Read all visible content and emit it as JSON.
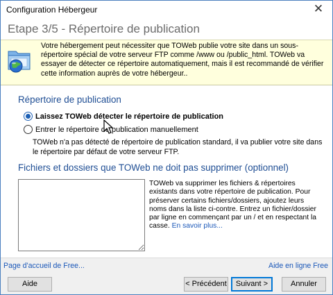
{
  "window": {
    "title": "Configuration Hébergeur",
    "close_glyph": "✕"
  },
  "step": {
    "title": "Etape 3/5 - Répertoire de publication"
  },
  "info": {
    "icon": "folder-globe-icon",
    "text": "Votre hébergement peut nécessiter que TOWeb publie votre site dans un sous-répertoire spécial de votre serveur FTP comme /www ou /public_html. TOWeb va essayer de détecter ce répertoire automatiquement, mais il est recommandé de vérifier cette information auprès de votre hébergeur.."
  },
  "publication": {
    "header": "Répertoire de publication",
    "option_auto": "Laissez TOWeb détecter le répertoire de publication",
    "option_manual": "Entrer le répertoire de publication manuellement",
    "selected": "auto",
    "description": "TOWeb n'a pas détecté de répertoire de publication standard, il va publier votre site dans le répertoire par défaut de votre serveur FTP."
  },
  "protected": {
    "header": "Fichiers et dossiers que TOWeb ne doit pas supprimer (optionnel)",
    "value": "",
    "help_text": "TOWeb va supprimer les fichiers & répertoires existants dans votre répertoire de publication. Pour préserver certains fichiers/dossiers, ajoutez leurs noms dans la liste ci-contre. Entrez un fichier/dossier par ligne en commençant par un / et en respectant la casse.",
    "help_link": "En savoir plus..."
  },
  "footer": {
    "home_link": "Page d'accueil de Free...",
    "help_link": "Aide en ligne Free"
  },
  "buttons": {
    "help": "Aide",
    "previous": "< Précédent",
    "next": "Suivant >",
    "cancel": "Annuler"
  },
  "colors": {
    "accent": "#1f4e94",
    "link": "#1a57b8",
    "info_background": "#ffffdd"
  }
}
